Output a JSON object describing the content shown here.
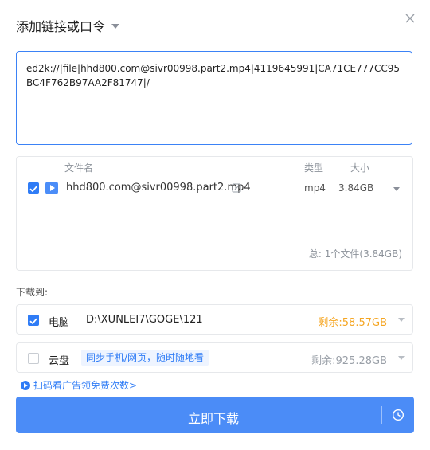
{
  "dialog": {
    "title": "添加链接或口令",
    "link_text": "ed2k://|file|hhd800.com@sivr00998.part2.mp4|4119645991|CA71CE777CC95BC4F762B97AA2F81747|/"
  },
  "file_table": {
    "headers": {
      "name": "文件名",
      "type": "类型",
      "size": "大小"
    },
    "rows": [
      {
        "name": "hhd800.com@sivr00998.part2.mp4",
        "type": "mp4",
        "size": "3.84GB",
        "checked": true
      }
    ],
    "total": "总:  1个文件(3.84GB)"
  },
  "download_to": {
    "label": "下载到:",
    "pc": {
      "name": "电脑",
      "path": "D:\\XUNLEI7\\GOGE\\121",
      "free": "剩余:58.57GB",
      "checked": true
    },
    "cloud": {
      "name": "云盘",
      "promo": "同步手机/网页，随时随地看",
      "free": "剩余:925.28GB",
      "checked": false
    }
  },
  "ad_text": "扫码看广告领免费次数>",
  "download_button": "立即下载",
  "colors": {
    "primary": "#4b8cf7",
    "accent_blue": "#2f7cf6",
    "free_orange": "#f5a623",
    "muted": "#8d939b"
  }
}
